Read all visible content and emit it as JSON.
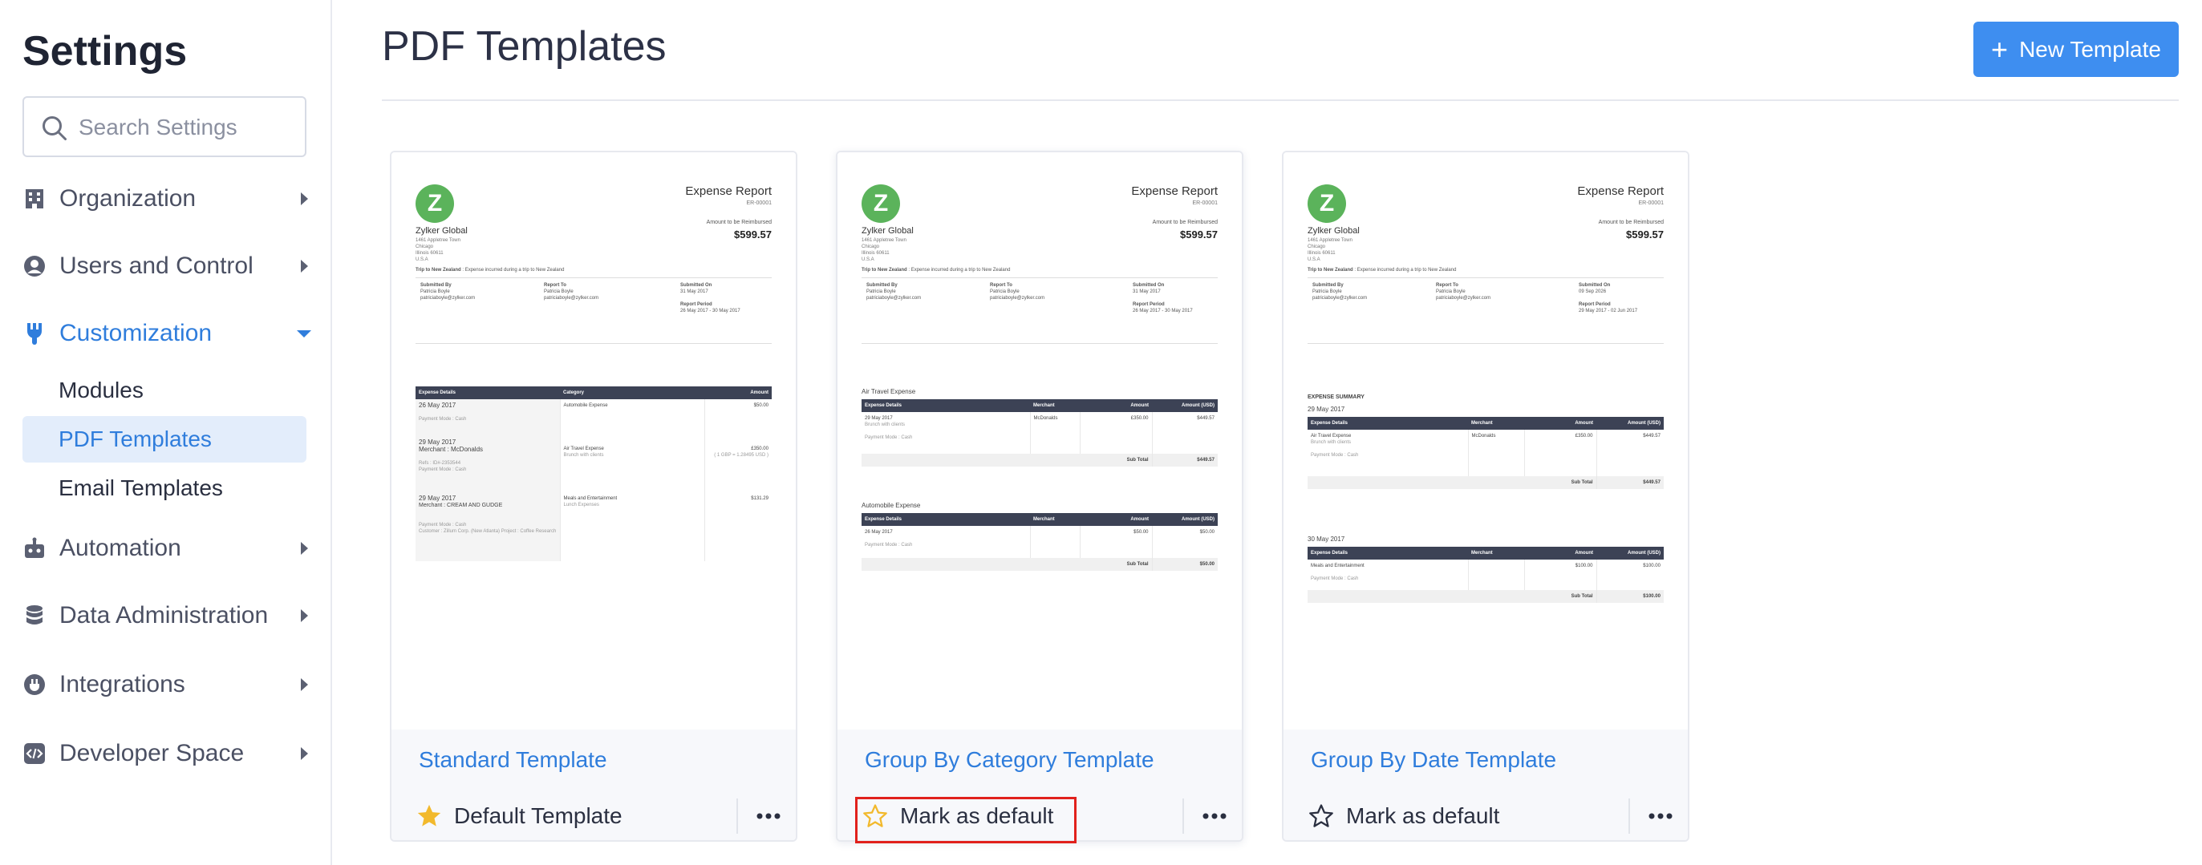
{
  "sidebar": {
    "title": "Settings",
    "search_placeholder": "Search Settings",
    "items": [
      {
        "label": "Organization",
        "icon": "building-icon"
      },
      {
        "label": "Users and Control",
        "icon": "user-icon"
      },
      {
        "label": "Customization",
        "icon": "brush-icon",
        "active": true
      },
      {
        "label": "Automation",
        "icon": "robot-icon"
      },
      {
        "label": "Data Administration",
        "icon": "database-icon"
      },
      {
        "label": "Integrations",
        "icon": "plug-icon"
      },
      {
        "label": "Developer Space",
        "icon": "code-icon"
      }
    ],
    "sub_items": [
      {
        "label": "Modules"
      },
      {
        "label": "PDF Templates",
        "selected": true
      },
      {
        "label": "Email Templates"
      }
    ]
  },
  "header": {
    "title": "PDF Templates",
    "new_button": "New Template",
    "new_button_icon": "plus-icon"
  },
  "templates": [
    {
      "name": "Standard Template",
      "action": "Default Template",
      "is_default": true
    },
    {
      "name": "Group By Category Template",
      "action": "Mark as default",
      "is_default": false
    },
    {
      "name": "Group By Date Template",
      "action": "Mark as default",
      "is_default": false
    }
  ],
  "preview": {
    "logo_letter": "Z",
    "company": "Zylker Global",
    "address": "1461 Appletree Town\nChicago\nIllinois 60611\nU.S.A",
    "report_title": "Expense Report",
    "report_no": "ER-00001",
    "amount_label": "Amount to be Reimbursed",
    "amount": "$599.57",
    "trip": "Trip to New Zealand",
    "trip_desc": " : Expense incurred during a trip to New Zealand",
    "submitted_by_label": "Submitted By",
    "submitted_by": "Patricia Boyle",
    "submitted_by_email": "patriciaboyle@zylker.com",
    "report_to_label": "Report To",
    "report_to": "Patricia Boyle",
    "report_to_email": "patriciaboyle@zylker.com",
    "submitted_on_label": "Submitted On",
    "submitted_on": "31 May 2017",
    "report_period_label": "Report Period",
    "report_period": "26 May 2017 - 30 May 2017",
    "col_details": "Expense Details",
    "col_category": "Category",
    "col_merchant": "Merchant",
    "col_amount": "Amount",
    "col_amount_usd": "Amount (USD)",
    "std_rows": [
      {
        "date": "26 May 2017",
        "line2": "",
        "mode": "Payment Mode : Cash",
        "extra": "",
        "category": "Automobile Expense",
        "cat_desc": "",
        "amount": "$50.00",
        "amount_sub": ""
      },
      {
        "date": "29 May 2017",
        "line2": "Merchant : McDonalds",
        "mode": "Payment Mode : Cash",
        "extra": "Refs : ID#-2353544",
        "category": "Air Travel Expense",
        "cat_desc": "Brunch with clients",
        "amount": "£350.00",
        "amount_sub": "( 1 GBP = 1.28495 USD )"
      },
      {
        "date": "29 May 2017",
        "line2": "Merchant : CREAM AND GUDGE",
        "mode": "Payment Mode : Cash",
        "extra": "Customer : Zillum Corp. (New Atlanta)  Project : Coffee Research",
        "category": "Meals and Entertainment",
        "cat_desc": "Lunch Expenses",
        "amount": "$131.29",
        "amount_sub": ""
      }
    ],
    "cat_groups": [
      {
        "title": "Air Travel Expense",
        "date": "29 May 2017",
        "desc": "Brunch with clients",
        "mode": "Payment Mode : Cash",
        "merchant": "McDonalds",
        "amount": "£350.00",
        "amount_usd": "$449.57",
        "subtotal_label": "Sub Total",
        "subtotal": "$449.57"
      },
      {
        "title": "Automobile Expense",
        "date": "26 May 2017",
        "desc": "",
        "mode": "Payment Mode : Cash",
        "merchant": "",
        "amount": "$50.00",
        "amount_usd": "$50.00",
        "subtotal_label": "Sub Total",
        "subtotal": "$50.00"
      }
    ],
    "date_summary": "EXPENSE SUMMARY",
    "date_groups": [
      {
        "title": "29 May 2017",
        "item": "Air Travel Expense",
        "desc": "Brunch with clients",
        "mode": "Payment Mode : Cash",
        "merchant": "McDonalds",
        "amount": "£350.00",
        "amount_usd": "$449.57",
        "subtotal_label": "Sub Total",
        "subtotal": "$449.57"
      },
      {
        "title": "30 May 2017",
        "item": "Meals and Entertainment",
        "desc": "",
        "mode": "Payment Mode : Cash",
        "merchant": "",
        "amount": "$100.00",
        "amount_usd": "$100.00",
        "subtotal_label": "Sub Total",
        "subtotal": "$100.00"
      }
    ],
    "date_submitted_on": "09 Sep 2026",
    "date_report_period": "29 May 2017 - 02 Jun 2017"
  },
  "colors": {
    "accent": "#3e8ef0",
    "link": "#2f7ddc",
    "star_filled": "#f2b92c",
    "star_outline_highlight": "#f2b92c",
    "highlight_box": "#e1211c",
    "table_header": "#3c4255",
    "logo": "#5bb35b"
  }
}
